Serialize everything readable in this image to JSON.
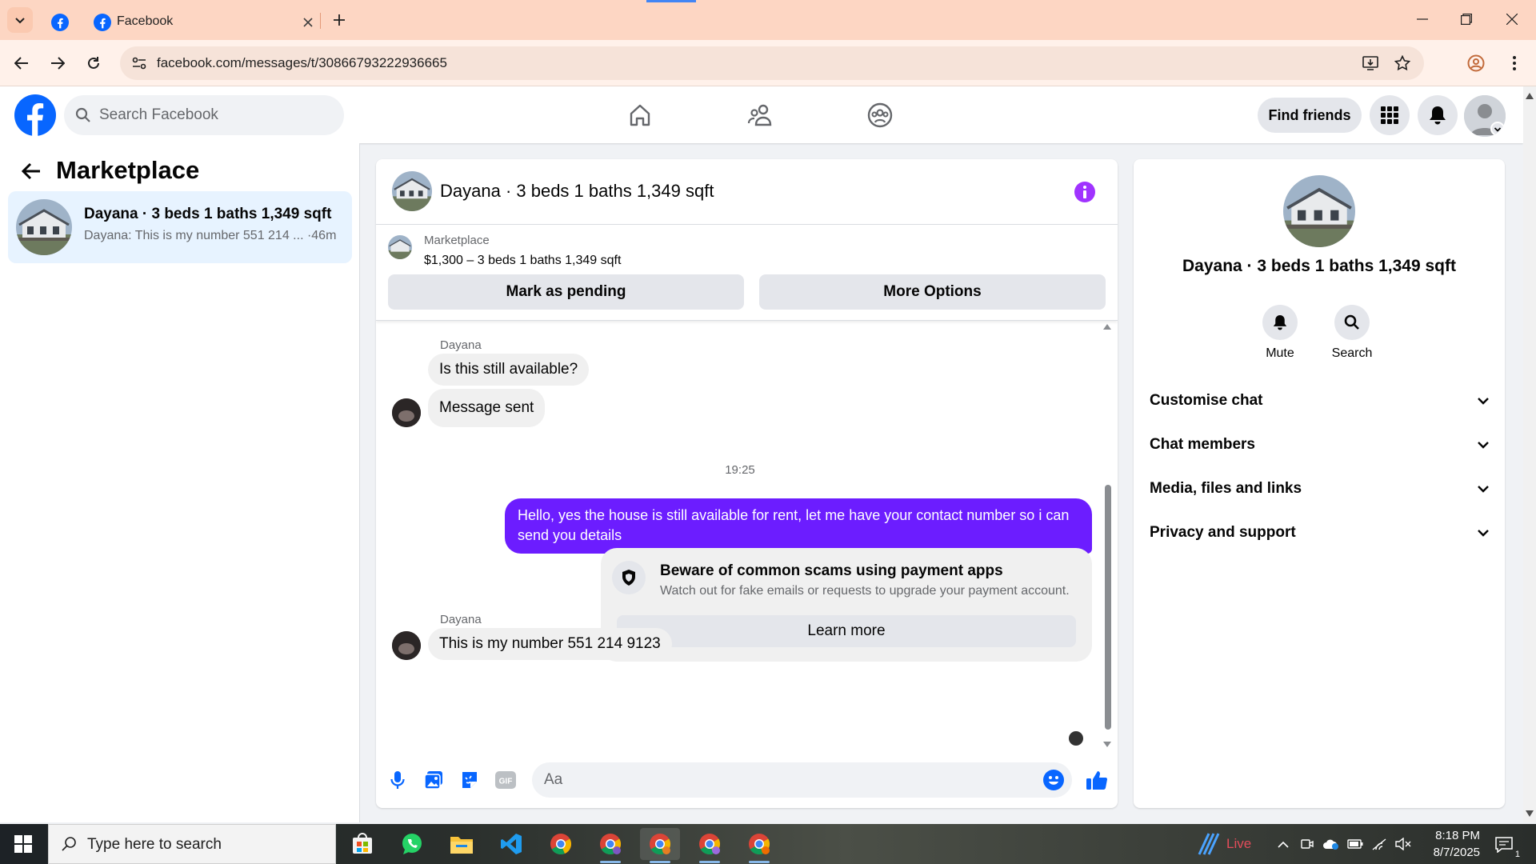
{
  "browser": {
    "tab_title": "Facebook",
    "url": "facebook.com/messages/t/30866793222936665"
  },
  "fb_header": {
    "search_placeholder": "Search Facebook",
    "find_friends_label": "Find friends"
  },
  "sidebar": {
    "title": "Marketplace",
    "conversation": {
      "name": "Dayana · 3 beds 1 baths 1,349 sqft",
      "preview": "Dayana: This is my number 551 214 ... ·46m"
    }
  },
  "chat": {
    "title": "Dayana · 3 beds 1 baths 1,349 sqft",
    "listing": {
      "source": "Marketplace",
      "detail": "$1,300 – 3 beds 1 baths 1,349 sqft"
    },
    "mark_pending_label": "Mark as pending",
    "more_options_label": "More Options",
    "messages": {
      "sender_1": "Dayana",
      "msg_1": "Is this still available?",
      "msg_2": "Message sent",
      "timestamp": "19:25",
      "outgoing": "Hello, yes the house is still available for rent, let me have your contact number so i can send you  details",
      "scam_title": "Beware of common scams using payment apps",
      "scam_desc": "Watch out for fake emails or requests to upgrade your payment account.",
      "learn_more": "Learn more",
      "sender_2": "Dayana",
      "msg_3": "This is my number 551 214 9123"
    },
    "composer_placeholder": "Aa"
  },
  "info_panel": {
    "title": "Dayana · 3 beds 1 baths 1,349 sqft",
    "mute_label": "Mute",
    "search_label": "Search",
    "sections": [
      "Customise chat",
      "Chat members",
      "Media, files and links",
      "Privacy and support"
    ]
  },
  "taskbar": {
    "search_placeholder": "Type here to search",
    "live_label": "Live",
    "time": "8:18 PM",
    "date": "8/7/2025",
    "notification_count": "1"
  },
  "colors": {
    "fb_blue": "#0866ff",
    "messenger_purple": "#6c1dff",
    "info_icon": "#a033ff"
  },
  "icons": [
    "tab-search-icon",
    "facebook-favicon",
    "close-icon",
    "plus-icon",
    "minimize-icon",
    "maximize-icon",
    "window-close-icon",
    "back-icon",
    "forward-icon",
    "reload-icon",
    "site-info-icon",
    "install-icon",
    "bookmark-star-icon",
    "profile-icon",
    "menu-dots-icon",
    "facebook-logo",
    "search-icon",
    "home-icon",
    "friends-icon",
    "groups-icon",
    "apps-grid-icon",
    "bell-icon",
    "avatar",
    "back-arrow-icon",
    "info-icon",
    "shield-icon",
    "mic-icon",
    "photo-icon",
    "sticker-icon",
    "gif-icon",
    "emoji-icon",
    "like-icon",
    "chevron-down-icon",
    "windows-icon",
    "whatsapp-icon",
    "file-explorer-icon",
    "vscode-icon",
    "chrome-icon"
  ]
}
